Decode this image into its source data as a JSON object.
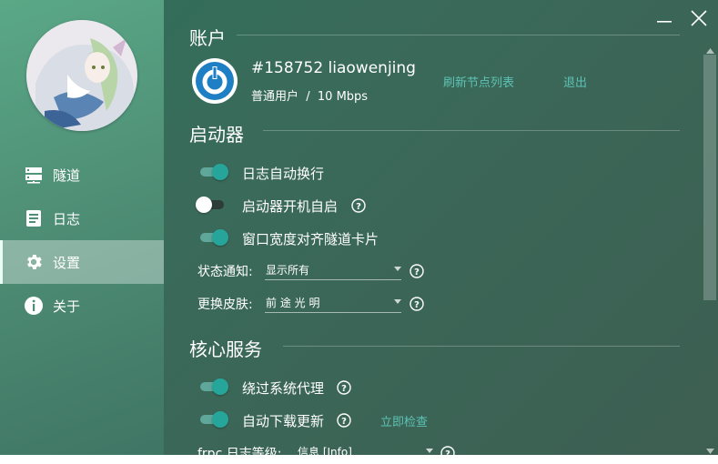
{
  "sidebar": {
    "items": [
      {
        "label": "隧道",
        "icon": "server-icon"
      },
      {
        "label": "日志",
        "icon": "log-icon"
      },
      {
        "label": "设置",
        "icon": "gear-icon",
        "active": true
      },
      {
        "label": "关于",
        "icon": "info-icon"
      }
    ]
  },
  "account": {
    "title": "账户",
    "user": "#158752 liaowenjing",
    "plan": "普通用户  /  10 Mbps",
    "refresh_link": "刷新节点列表",
    "logout_link": "退出"
  },
  "launcher": {
    "title": "启动器",
    "options": [
      {
        "label": "日志自动换行",
        "on": true,
        "help": false
      },
      {
        "label": "启动器开机自启",
        "on": false,
        "help": true
      },
      {
        "label": "窗口宽度对齐隧道卡片",
        "on": true,
        "help": false
      }
    ],
    "notify_label": "状态通知:",
    "notify_value": "显示所有",
    "skin_label": "更换皮肤:",
    "skin_value": "前 途 光 明"
  },
  "core": {
    "title": "核心服务",
    "options": [
      {
        "label": "绕过系统代理",
        "on": true,
        "help": true
      },
      {
        "label": "自动下载更新",
        "on": true,
        "help": true
      }
    ],
    "check_now_link": "立即检查",
    "frpc_log_label": "frpc 日志等级:",
    "frpc_log_value": "信息 [Info]"
  },
  "colors": {
    "accent": "#26a69a",
    "link": "#5cc3b4",
    "sidebar_active": "#a9cdb9"
  }
}
